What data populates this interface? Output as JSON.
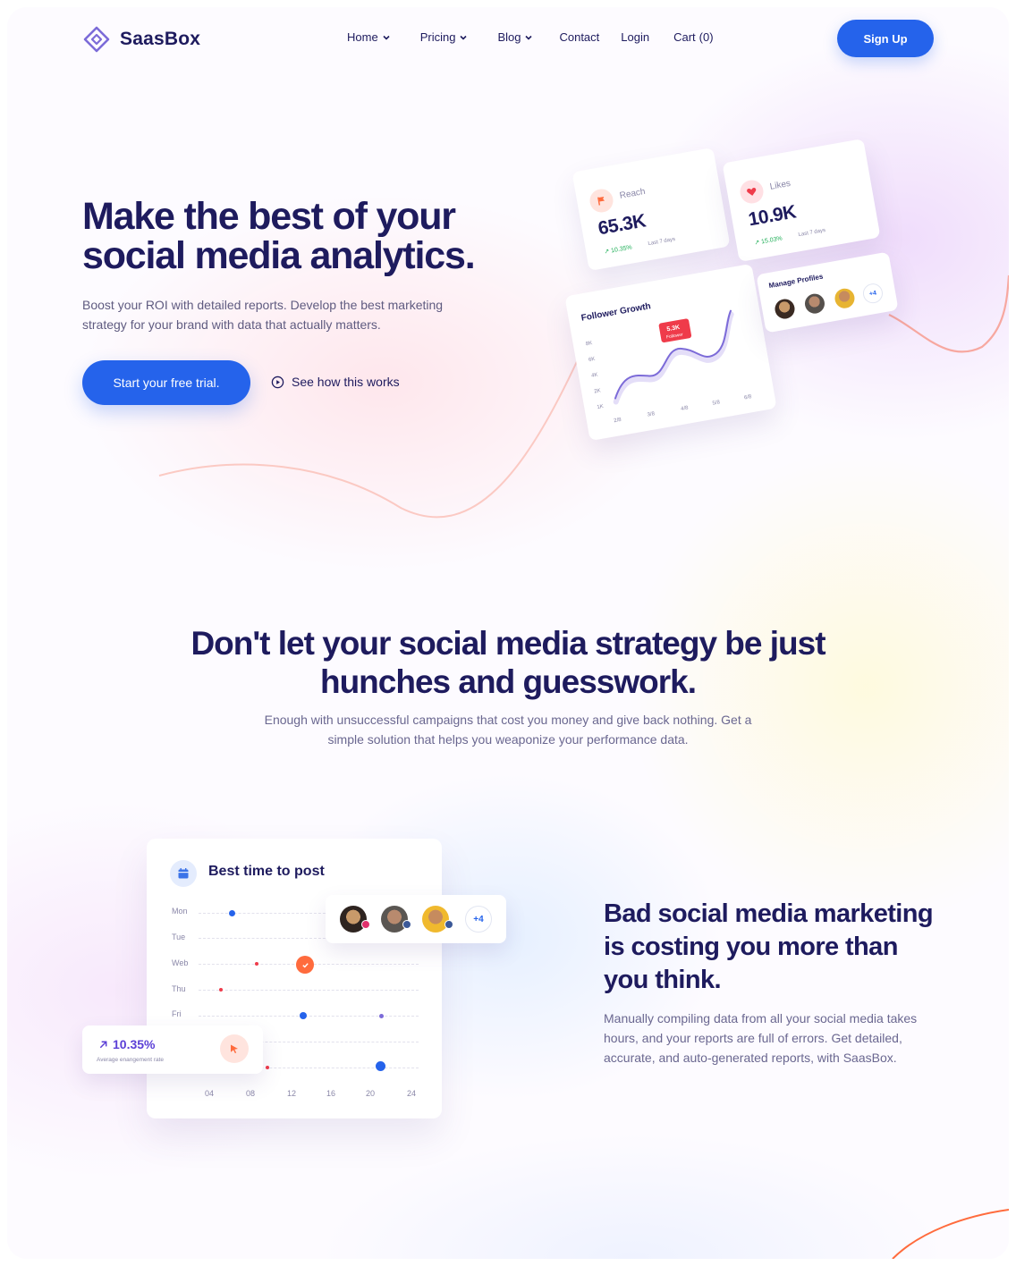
{
  "brand": {
    "name": "SaasBox"
  },
  "nav": {
    "items": [
      {
        "label": "Home",
        "dropdown": true
      },
      {
        "label": "Pricing",
        "dropdown": true
      },
      {
        "label": "Blog",
        "dropdown": true
      },
      {
        "label": "Contact",
        "dropdown": false
      },
      {
        "label": "Login",
        "dropdown": false
      }
    ],
    "cart_label": "Cart",
    "cart_count": "(0)",
    "signup_label": "Sign Up"
  },
  "hero": {
    "title": "Make the best of your social media analytics.",
    "subtitle": "Boost your ROI with detailed reports. Develop the best marketing strategy for your brand with data that actually matters.",
    "cta_label": "Start your free trial.",
    "secondary_label": "See how this works"
  },
  "stats": {
    "reach": {
      "label": "Reach",
      "value": "65.3K",
      "growth": "10.35%",
      "period": "Last 7 days"
    },
    "likes": {
      "label": "Likes",
      "value": "10.9K",
      "growth": "15.03%",
      "period": "Last 7 days"
    }
  },
  "follower_growth": {
    "title": "Follower Growth",
    "tooltip_value": "5.3K",
    "tooltip_label": "Follower",
    "y_ticks": [
      "8K",
      "6K",
      "4K",
      "2K",
      "1K"
    ],
    "x_ticks": [
      "2/8",
      "3/8",
      "4/8",
      "5/8",
      "6/8"
    ]
  },
  "manage_profiles": {
    "title": "Manage Profiles",
    "more": "+4"
  },
  "section2": {
    "title": "Don't let your social media strategy be just hunches and guesswork.",
    "subtitle": "Enough with unsuccessful campaigns that cost you money and give back nothing. Get a simple solution that helps you weaponize your performance data."
  },
  "best_time": {
    "title": "Best time to post",
    "days": [
      "Mon",
      "Tue",
      "Web",
      "Thu",
      "Fri"
    ],
    "hours": [
      "04",
      "08",
      "12",
      "16",
      "20",
      "24"
    ],
    "more": "+4"
  },
  "engagement": {
    "value": "10.35%",
    "label": "Average enangement rate"
  },
  "section3": {
    "title": "Bad social media marketing is costing you more than you think.",
    "subtitle": "Manually compiling data from all your social media takes hours, and your reports are full of errors. Get detailed, accurate, and auto-generated reports, with SaasBox."
  },
  "colors": {
    "primary": "#2563eb",
    "heading": "#1e1b5e",
    "accent_orange": "#ff6b3d",
    "accent_red": "#ef3b4a",
    "accent_purple": "#7c6bd8"
  }
}
